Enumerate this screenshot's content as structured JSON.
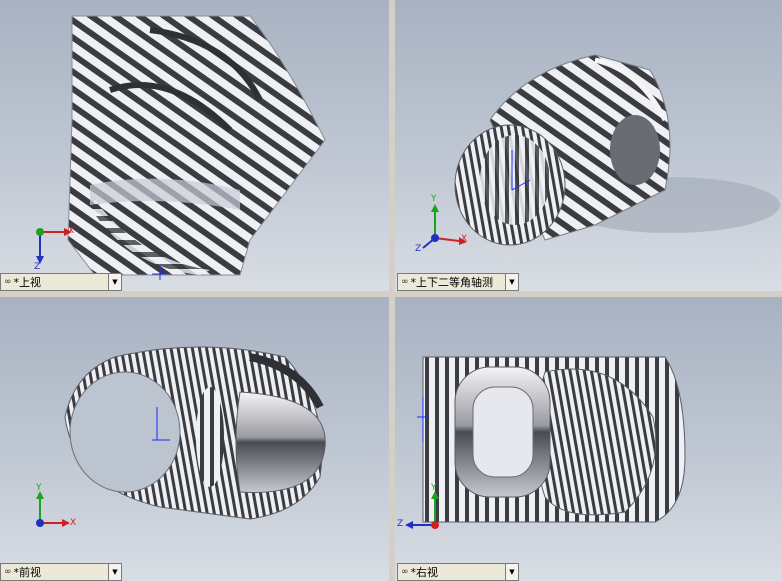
{
  "views": {
    "top": {
      "name": "*上视"
    },
    "isometric": {
      "name": "*上下二等角轴测"
    },
    "front": {
      "name": "*前视"
    },
    "right": {
      "name": "*右视"
    }
  },
  "axes": {
    "x": "X",
    "y": "Y",
    "z": "Z"
  },
  "colors": {
    "axis_x": "#d02020",
    "axis_y": "#20a020",
    "axis_z": "#2030c0",
    "ref_axis": "#1a2cff"
  },
  "icons": {
    "view_link": "link-icon",
    "dropdown": "chevron-down-icon"
  }
}
